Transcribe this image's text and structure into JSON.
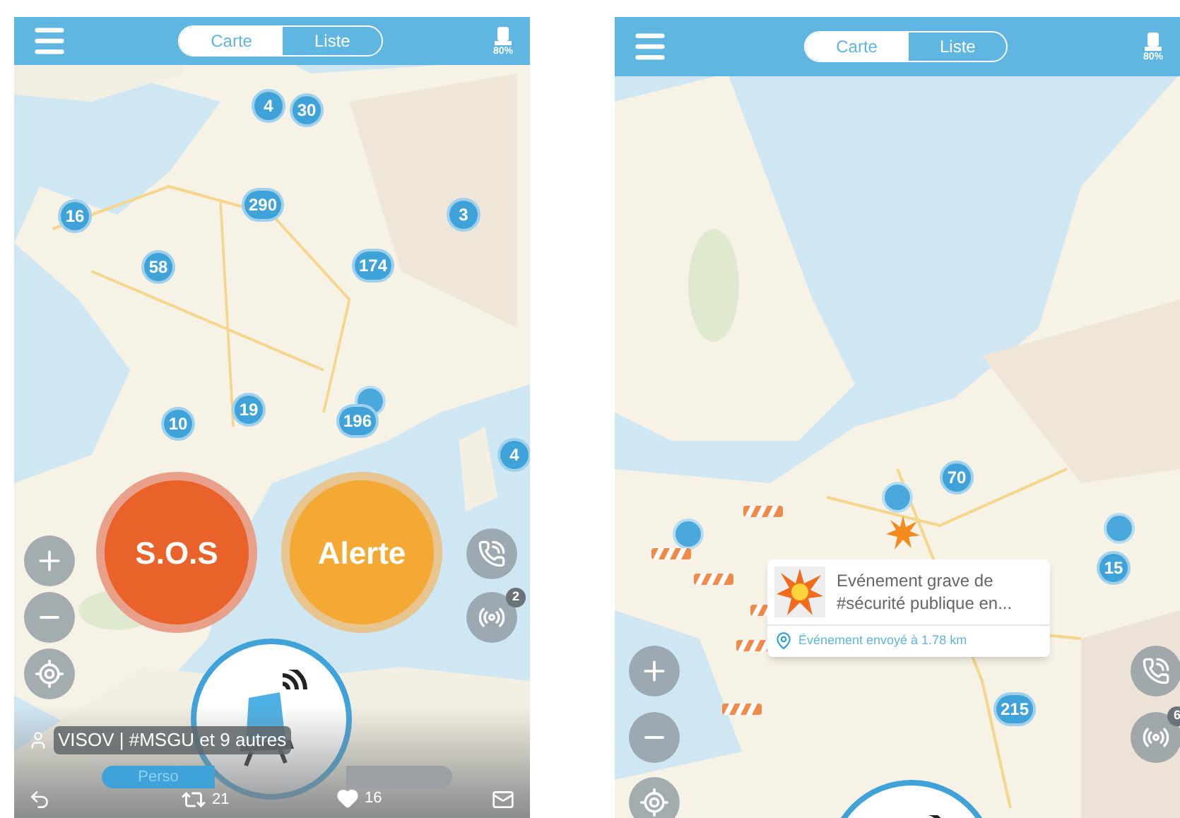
{
  "screens": [
    {
      "header": {
        "tabs": [
          {
            "label": "Carte",
            "selected": true
          },
          {
            "label": "Liste",
            "selected": false
          }
        ],
        "battery": "80%"
      },
      "clusters": [
        {
          "count": "4"
        },
        {
          "count": "30"
        },
        {
          "count": "16"
        },
        {
          "count": "290"
        },
        {
          "count": "3"
        },
        {
          "count": "58"
        },
        {
          "count": "174"
        },
        {
          "count": "19"
        },
        {
          "count": "10"
        },
        {
          "count": "196"
        },
        {
          "count": "4"
        }
      ],
      "actions": [
        {
          "label": "S.O.S",
          "kind": "sos"
        },
        {
          "label": "Alerte",
          "kind": "alert"
        }
      ],
      "badge": "2",
      "author": "VISOV | #MSGU et 9 autres",
      "perso_tab": {
        "label": "Perso",
        "selected": true
      },
      "stats": {
        "shares": "21",
        "likes": "16"
      }
    },
    {
      "header": {
        "tabs": [
          {
            "label": "Carte",
            "selected": true
          },
          {
            "label": "Liste",
            "selected": false
          }
        ],
        "battery": "80%"
      },
      "clusters": [
        {
          "count": "70"
        },
        {
          "count": "15"
        },
        {
          "count": "215"
        }
      ],
      "popup": {
        "title": "Evénement grave de #sécurité publique en...",
        "distance": "Événement envoyé à 1.78 km"
      },
      "badge": "6"
    }
  ]
}
